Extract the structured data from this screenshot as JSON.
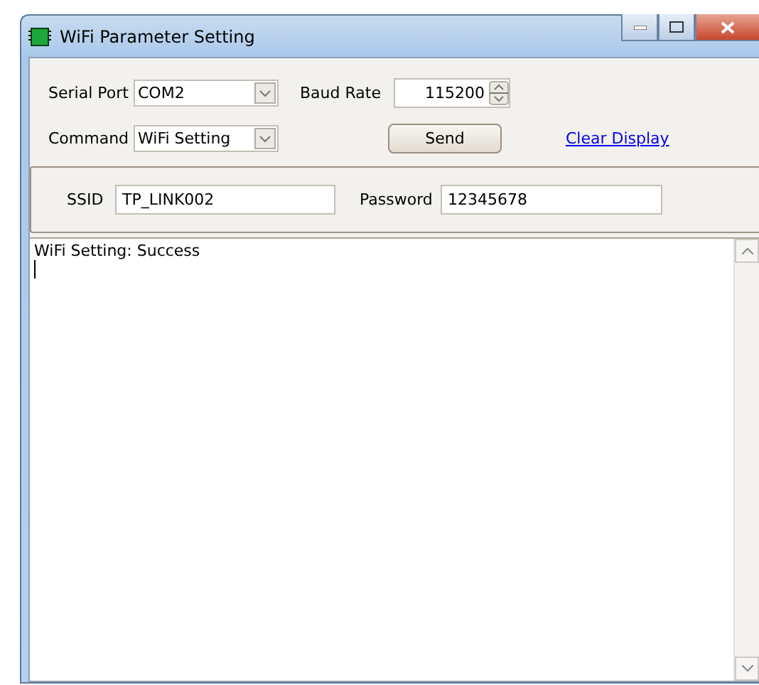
{
  "window": {
    "title": "WiFi Parameter Setting"
  },
  "serial_port": {
    "label": "Serial Port",
    "value": "COM2"
  },
  "baud_rate": {
    "label": "Baud Rate",
    "value": "115200"
  },
  "command": {
    "label": "Command",
    "value": "WiFi Setting"
  },
  "send_button": "Send",
  "clear_link": "Clear Display",
  "ssid": {
    "label": "SSID",
    "value": "TP_LINK002"
  },
  "password": {
    "label": "Password",
    "value": "12345678"
  },
  "log": [
    "WiFi Setting: Success"
  ]
}
